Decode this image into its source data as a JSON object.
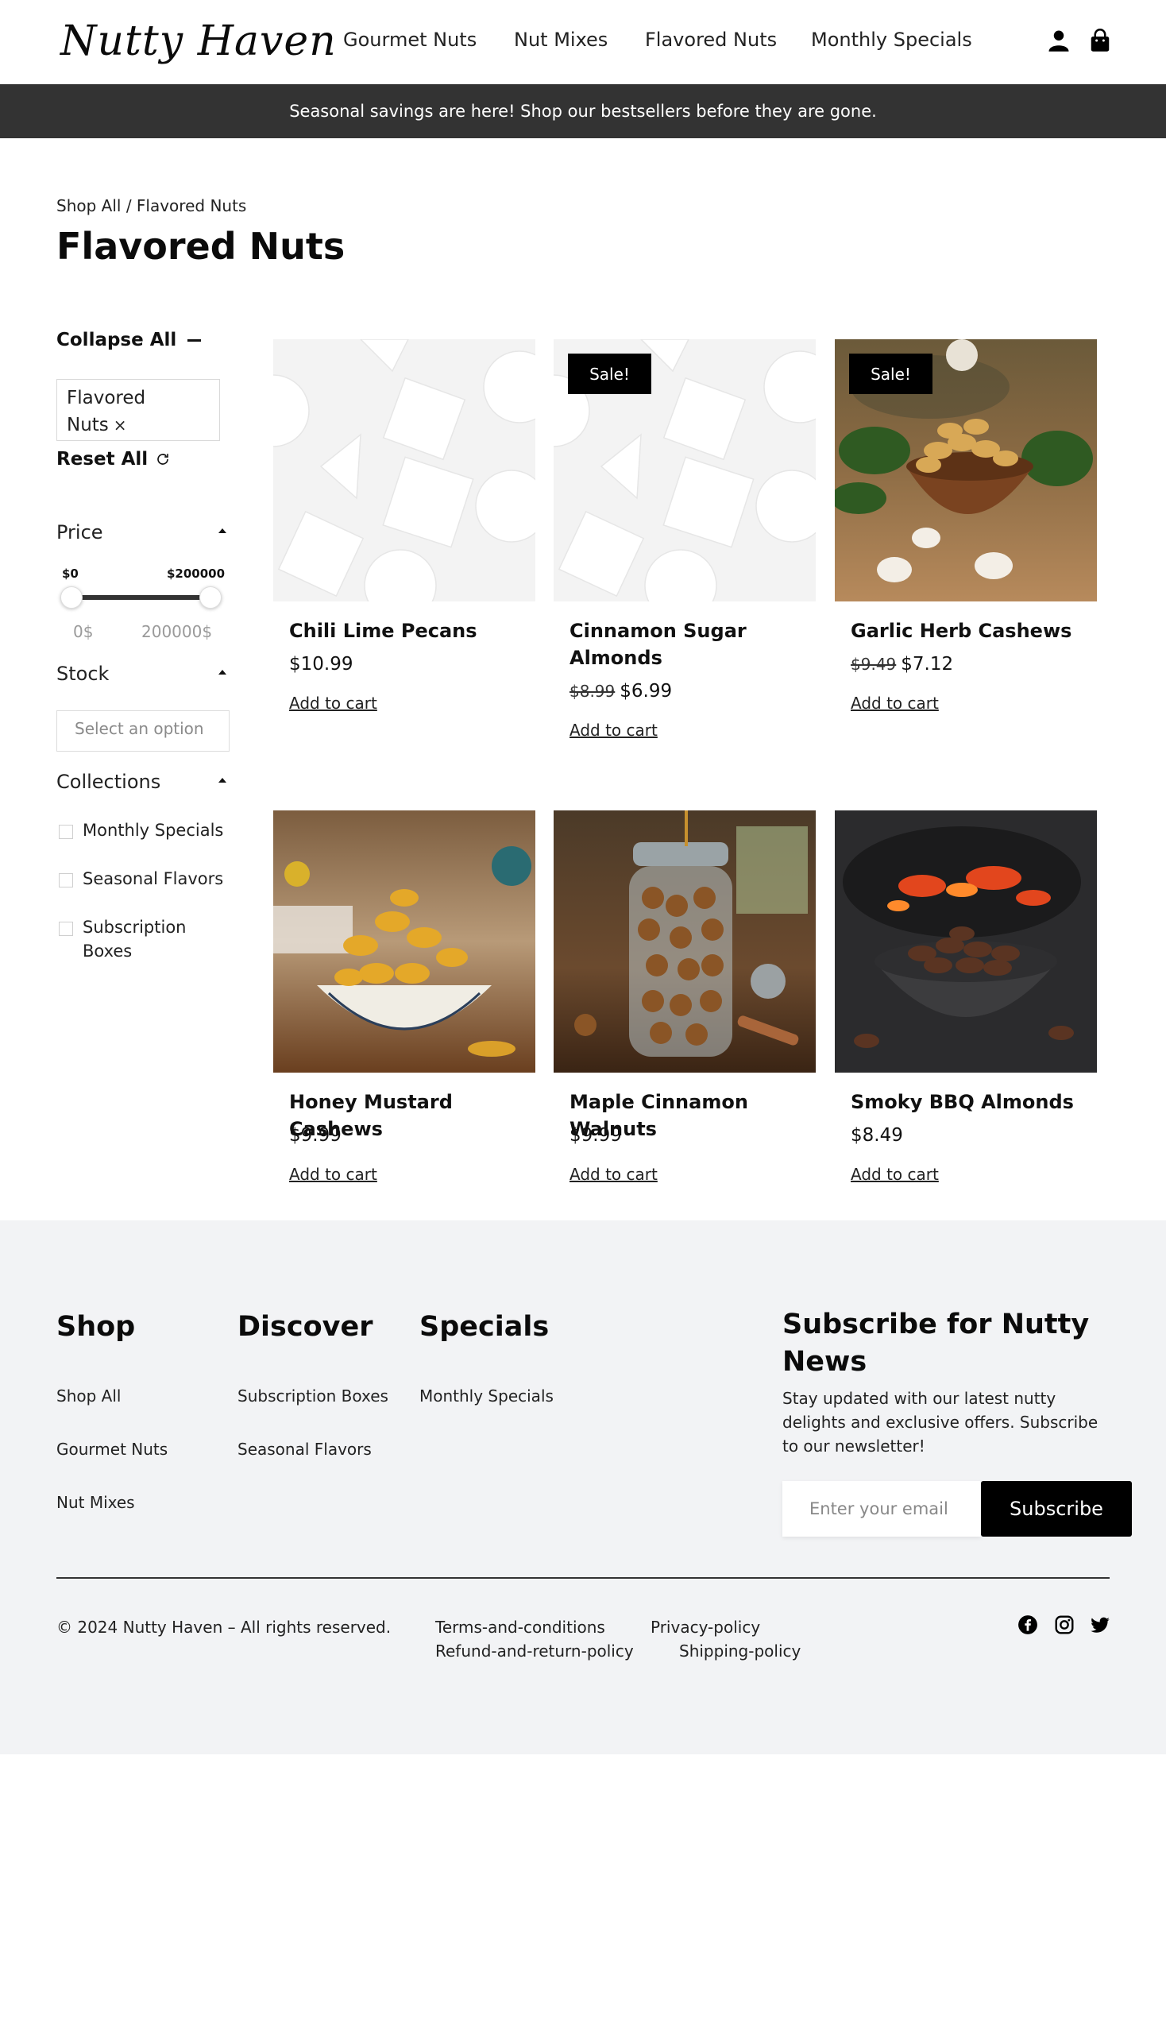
{
  "header": {
    "logo": "Nutty Haven",
    "nav": [
      "Gourmet Nuts",
      "Nut Mixes",
      "Flavored Nuts",
      "Monthly Specials"
    ],
    "icons": [
      "user-icon",
      "shopping-bag-icon"
    ]
  },
  "announcement": "Seasonal savings are here! Shop our bestsellers before they are gone.",
  "breadcrumb": "Shop All / Flavored Nuts",
  "page_title": "Flavored Nuts",
  "sidebar": {
    "collapse_all": "Collapse All",
    "active_filter": "Flavored Nuts",
    "remove_symbol": "×",
    "reset_all": "Reset All",
    "price": {
      "label": "Price",
      "min_label": "$0",
      "max_label": "$200000",
      "min_value": "0$",
      "max_value": "200000$",
      "range": [
        0,
        200000
      ],
      "selected": [
        0,
        200000
      ]
    },
    "stock": {
      "label": "Stock",
      "placeholder": "Select an option"
    },
    "collections": {
      "label": "Collections",
      "items": [
        "Monthly Specials",
        "Seasonal Flavors",
        "Subscription Boxes"
      ]
    }
  },
  "products": [
    {
      "name": "Chili Lime Pecans",
      "price": "$10.99",
      "old_price": "",
      "sale": false,
      "image": "placeholder-image",
      "cta": "Add to cart"
    },
    {
      "name": "Cinnamon Sugar Almonds",
      "price": "$6.99",
      "old_price": "$8.99",
      "sale": true,
      "badge": "Sale!",
      "image": "placeholder-image",
      "cta": "Add to cart"
    },
    {
      "name": "Garlic Herb Cashews",
      "price": "$7.12",
      "old_price": "$9.49",
      "sale": true,
      "badge": "Sale!",
      "image": "cashews-wooden-bowl-photo",
      "cta": "Add to cart"
    },
    {
      "name": "Honey Mustard Cashews",
      "price": "$9.99",
      "old_price": "",
      "sale": false,
      "image": "honey-cashews-bowl-photo",
      "cta": "Add to cart"
    },
    {
      "name": "Maple Cinnamon Walnuts",
      "price": "$9.99",
      "old_price": "",
      "sale": false,
      "image": "walnuts-jar-photo",
      "cta": "Add to cart"
    },
    {
      "name": "Smoky BBQ Almonds",
      "price": "$8.49",
      "old_price": "",
      "sale": false,
      "image": "almonds-grill-photo",
      "cta": "Add to cart"
    }
  ],
  "footer": {
    "columns": [
      {
        "title": "Shop",
        "links": [
          "Shop All",
          "Gourmet Nuts",
          "Nut Mixes"
        ]
      },
      {
        "title": "Discover",
        "links": [
          "Subscription Boxes",
          "Seasonal Flavors"
        ]
      },
      {
        "title": "Specials",
        "links": [
          "Monthly Specials"
        ]
      }
    ],
    "subscribe": {
      "title": "Subscribe for Nutty News",
      "text": "Stay updated with our latest nutty delights and exclusive offers. Subscribe to our newsletter!",
      "placeholder": "Enter your email",
      "button": "Subscribe"
    },
    "copyright": "© 2024 Nutty Haven – All rights reserved.",
    "legal_links": [
      "Terms-and-conditions",
      "Privacy-policy",
      "Refund-and-return-policy",
      "Shipping-policy"
    ],
    "social": [
      "facebook-icon",
      "instagram-icon",
      "twitter-icon"
    ]
  },
  "colors": {
    "announcement_bg": "#333333",
    "footer_bg": "#f2f3f5",
    "badge_bg": "#000000",
    "button_bg": "#000000"
  }
}
